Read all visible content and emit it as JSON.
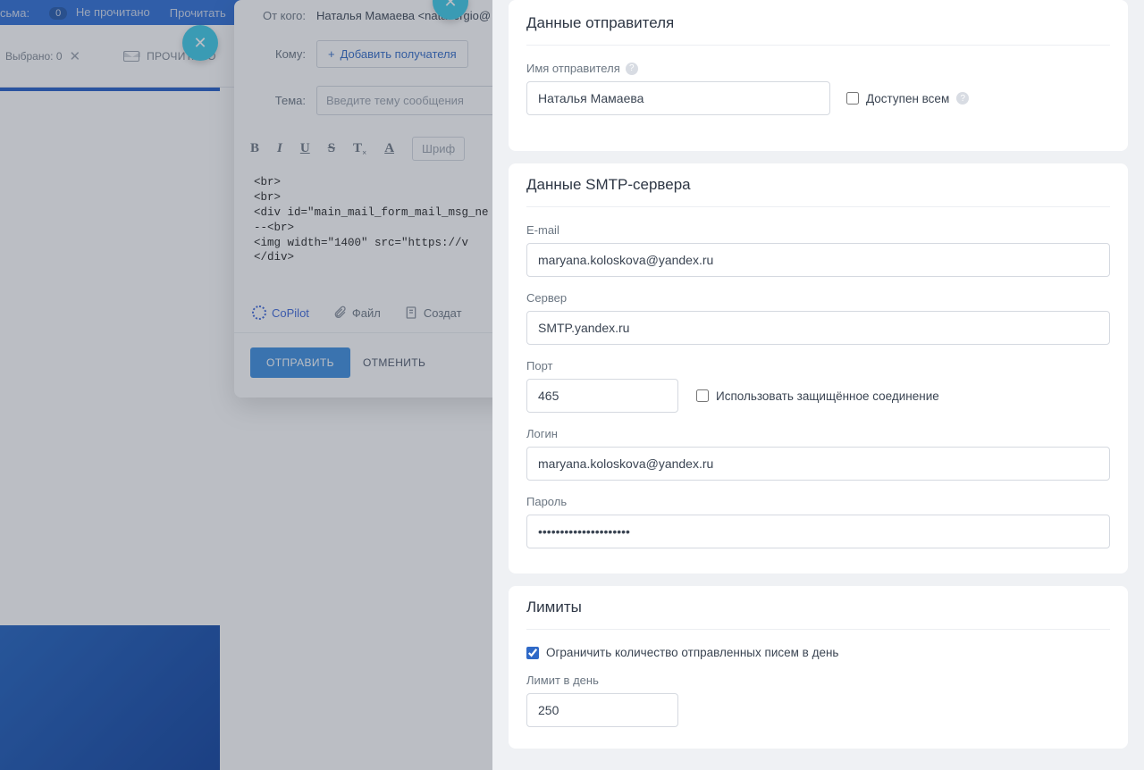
{
  "topbar": {
    "label_letters": "сьма:",
    "unread_badge": "0",
    "unread_label": "Не прочитано",
    "read_label": "Прочитать"
  },
  "toolbar": {
    "selected_label": "Выбрано: 0",
    "read_action": "ПРОЧИТАНО"
  },
  "compose": {
    "from_label": "От кого:",
    "from_value": "Наталья Мамаева <natasergio@",
    "to_label": "Кому:",
    "add_recipient": "Добавить получателя",
    "subject_label": "Тема:",
    "subject_placeholder": "Введите тему сообщения",
    "font_placeholder": "Шриф",
    "body_lines": [
      "<br>",
      "<br>",
      "<div id=\"main_mail_form_mail_msg_ne",
      "        --<br>",
      "        <img width=\"1400\" src=\"https://v",
      "</div>"
    ],
    "copilot": "CoPilot",
    "file": "Файл",
    "create": "Создат",
    "send": "ОТПРАВИТЬ",
    "cancel": "ОТМЕНИТЬ"
  },
  "panel": {
    "sender_card": {
      "title": "Данные отправителя",
      "name_label": "Имя отправителя",
      "name_value": "Наталья Мамаева",
      "public_label": "Доступен всем"
    },
    "smtp_card": {
      "title": "Данные SMTP-сервера",
      "email_label": "E-mail",
      "email_value": "maryana.koloskova@yandex.ru",
      "server_label": "Сервер",
      "server_value": "SMTP.yandex.ru",
      "port_label": "Порт",
      "port_value": "465",
      "ssl_label": "Использовать защищённое соединение",
      "login_label": "Логин",
      "login_value": "maryana.koloskova@yandex.ru",
      "password_label": "Пароль",
      "password_value": "•••••••••••••••••••••"
    },
    "limits_card": {
      "title": "Лимиты",
      "limit_checkbox": "Ограничить количество отправленных писем в день",
      "limit_label": "Лимит в день",
      "limit_value": "250"
    }
  }
}
